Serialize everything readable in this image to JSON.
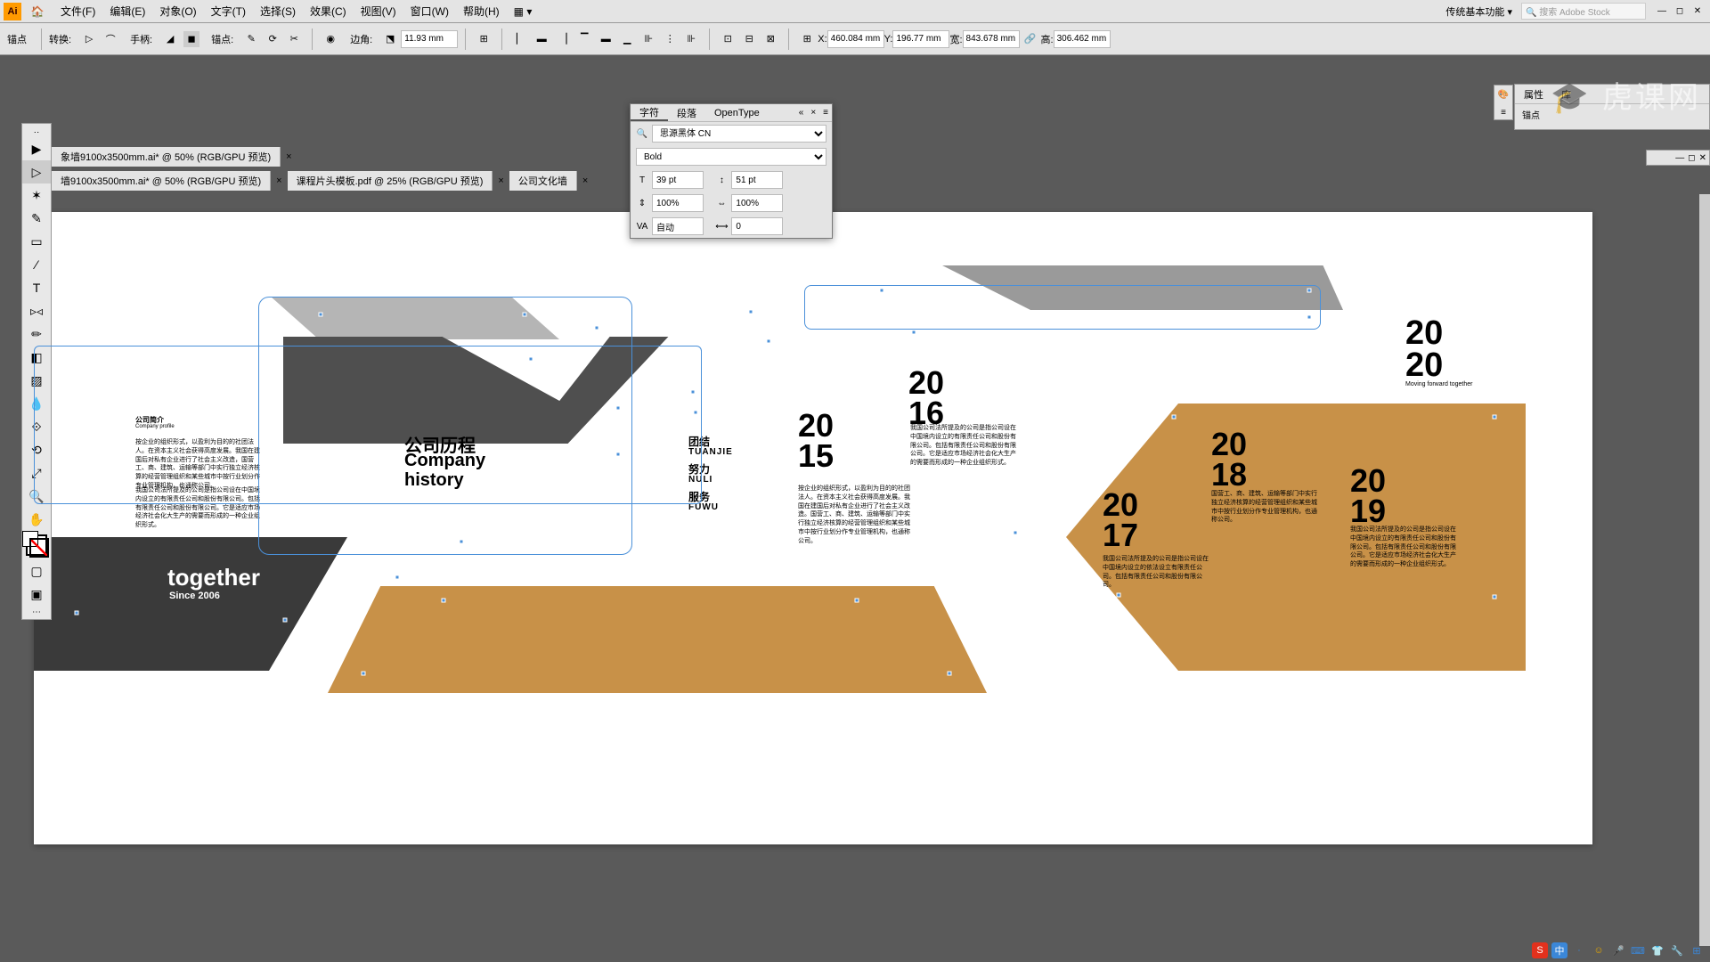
{
  "menu": {
    "logo": "Ai",
    "items": [
      "文件(F)",
      "编辑(E)",
      "对象(O)",
      "文字(T)",
      "选择(S)",
      "效果(C)",
      "视图(V)",
      "窗口(W)",
      "帮助(H)"
    ],
    "workspace": "传统基本功能",
    "search_placeholder": "搜索 Adobe Stock"
  },
  "ctrl": {
    "label_anchor": "锚点",
    "label_convert": "转换:",
    "label_handle": "手柄:",
    "label_anchors": "锚点:",
    "label_corners": "边角:",
    "corner_val": "11.93 mm",
    "x_val": "460.084 mm",
    "y_val": "196.77 mm",
    "w_val": "843.678 mm",
    "h_val": "306.462 mm",
    "x_lbl": "X:",
    "y_lbl": "Y:",
    "w_lbl": "宽:",
    "h_lbl": "高:"
  },
  "tabs": {
    "row1": "象墙9100x3500mm.ai* @ 50% (RGB/GPU 预览)",
    "row2": [
      "墙9100x3500mm.ai* @ 50% (RGB/GPU 预览)",
      "课程片头模板.pdf @ 25% (RGB/GPU 预览)",
      "公司文化墙"
    ]
  },
  "char_panel": {
    "tabs": [
      "字符",
      "段落",
      "OpenType"
    ],
    "font": "思源黑体 CN",
    "weight": "Bold",
    "size": "39 pt",
    "leading": "51 pt",
    "hscale": "100%",
    "vscale": "100%",
    "kerning": "自动",
    "tracking": "0"
  },
  "right": {
    "tabs": [
      "属性",
      "库"
    ],
    "strip_label": "锚点"
  },
  "art": {
    "profile_head": "公司简介",
    "profile_sub": "Company profile",
    "body1": "按企业的组织形式，以盈利为目的的社团法人。在资本主义社会获得高度发展。我国在建国后对私有企业进行了社会主义改造，国营工、商、建筑、运输等部门中实行独立经济核算的经营管理组织和某些城市中按行业划分作专业管理机构，也通称公司。",
    "body2": "我国公司法所提及的公司是指公司设在中国境内设立的有限责任公司和股份有限公司。包括有限责任公司和股份有限公司。它是适应市场经济社会化大生产的需要而形成的一种企业组织形式。",
    "history_cn": "公司历程",
    "history_en1": "Company",
    "history_en2": "history",
    "tuanjie": "团结",
    "tuanjie_p": "TUANJIE",
    "nuli": "努力",
    "nuli_p": "NULI",
    "fuwu": "服务",
    "fuwu_p": "FUWU",
    "y2015": "20\n15",
    "y2016": "20\n16",
    "y2017": "20\n17",
    "y2018": "20\n18",
    "y2019": "20\n19",
    "y2020": "20\n20",
    "y2020_sub": "Moving forward together",
    "together": "together",
    "since": "Since 2006",
    "pb2015": "按企业的组织形式，以盈利为目的的社团法人。在资本主义社会获得高度发展。我国在建国后对私有企业进行了社会主义改造。国营工、商、建筑、运输等部门中实行独立经济核算的经营管理组织和某些城市中按行业划分作专业管理机构，也通称公司。",
    "pb2016": "我国公司法所提及的公司是指公司设在中国境内设立的有限责任公司和股份有限公司。包括有限责任公司和股份有限公司。它是适应市场经济社会化大生产的需要而形成的一种企业组织形式。",
    "pb2017": "我国公司法所提及的公司是指公司设在中国境内设立的依法设立有限责任公司。包括有限责任公司和股份有限公司。",
    "pb2018": "国营工、商、建筑、运输等部门中实行独立经济核算的经营管理组织和某些城市中按行业划分作专业管理机构，也通称公司。",
    "pb2019": "我国公司法所提及的公司是指公司设在中国境内设立的有限责任公司和股份有限公司。包括有限责任公司和股份有限公司。它是适应市场经济社会化大生产的需要而形成的一种企业组织形式。"
  },
  "watermark": "虎课网"
}
